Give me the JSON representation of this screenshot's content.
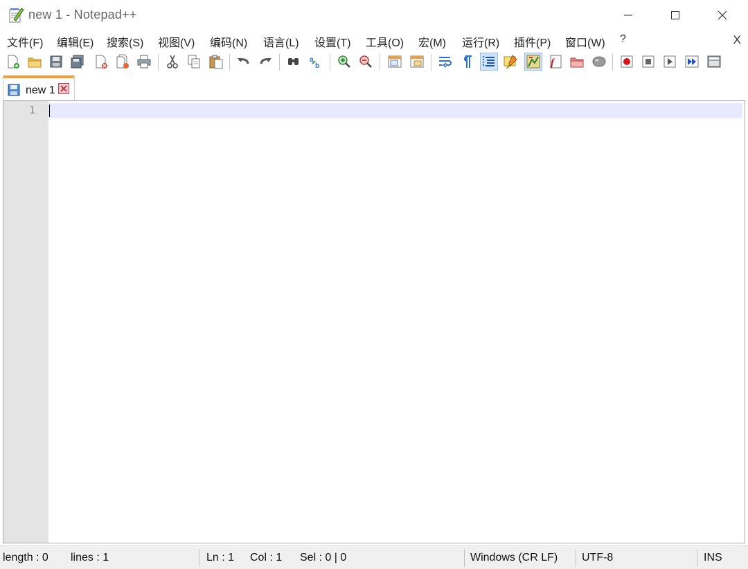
{
  "window": {
    "title": "new 1 - Notepad++",
    "minimize_icon": "minimize-icon",
    "maximize_icon": "maximize-icon",
    "close_icon": "close-icon"
  },
  "menu": {
    "items": [
      {
        "label": "文件(F)"
      },
      {
        "label": "编辑(E)"
      },
      {
        "label": "搜索(S)"
      },
      {
        "label": "视图(V)"
      },
      {
        "label": "编码(N)"
      },
      {
        "label": "语言(L)"
      },
      {
        "label": "设置(T)"
      },
      {
        "label": "工具(O)"
      },
      {
        "label": "宏(M)"
      },
      {
        "label": "运行(R)"
      },
      {
        "label": "插件(P)"
      },
      {
        "label": "窗口(W)"
      },
      {
        "label": "?"
      }
    ],
    "close_label": "X"
  },
  "toolbar": {
    "buttons": [
      {
        "icon": "new-file-icon"
      },
      {
        "icon": "open-file-icon"
      },
      {
        "icon": "save-icon"
      },
      {
        "icon": "save-all-icon"
      },
      {
        "icon": "close-file-icon"
      },
      {
        "icon": "close-all-icon"
      },
      {
        "icon": "print-icon"
      },
      {
        "icon": "cut-icon"
      },
      {
        "icon": "copy-icon"
      },
      {
        "icon": "paste-icon"
      },
      {
        "icon": "undo-icon"
      },
      {
        "icon": "redo-icon"
      },
      {
        "icon": "find-icon"
      },
      {
        "icon": "replace-icon"
      },
      {
        "icon": "zoom-in-icon"
      },
      {
        "icon": "zoom-out-icon"
      },
      {
        "icon": "sync-vertical-icon"
      },
      {
        "icon": "sync-horizontal-icon"
      },
      {
        "icon": "word-wrap-icon"
      },
      {
        "icon": "show-all-characters-icon"
      },
      {
        "icon": "indent-guide-icon"
      },
      {
        "icon": "user-language-icon"
      },
      {
        "icon": "document-map-icon"
      },
      {
        "icon": "function-list-icon"
      },
      {
        "icon": "folder-as-workspace-icon"
      },
      {
        "icon": "monitoring-icon"
      },
      {
        "icon": "record-macro-icon"
      },
      {
        "icon": "stop-recording-icon"
      },
      {
        "icon": "play-macro-icon"
      },
      {
        "icon": "run-macro-multiple-icon"
      },
      {
        "icon": "save-macro-icon"
      }
    ]
  },
  "tabs": [
    {
      "label": "new 1",
      "icon": "tab-save-icon",
      "close_icon": "tab-close-icon",
      "active": true
    }
  ],
  "editor": {
    "line_numbers": [
      "1"
    ],
    "current_line_color": "#e8e8ff"
  },
  "status": {
    "length": "length : 0",
    "lines": "lines : 1",
    "ln": "Ln : 1",
    "col": "Col : 1",
    "sel": "Sel : 0 | 0",
    "eol": "Windows (CR LF)",
    "encoding": "UTF-8",
    "mode": "INS"
  },
  "colors": {
    "tab_accent": "#f59d36",
    "active_toolbar_bg": "#cfe3f7",
    "gutter_bg": "#e4e4e4"
  }
}
